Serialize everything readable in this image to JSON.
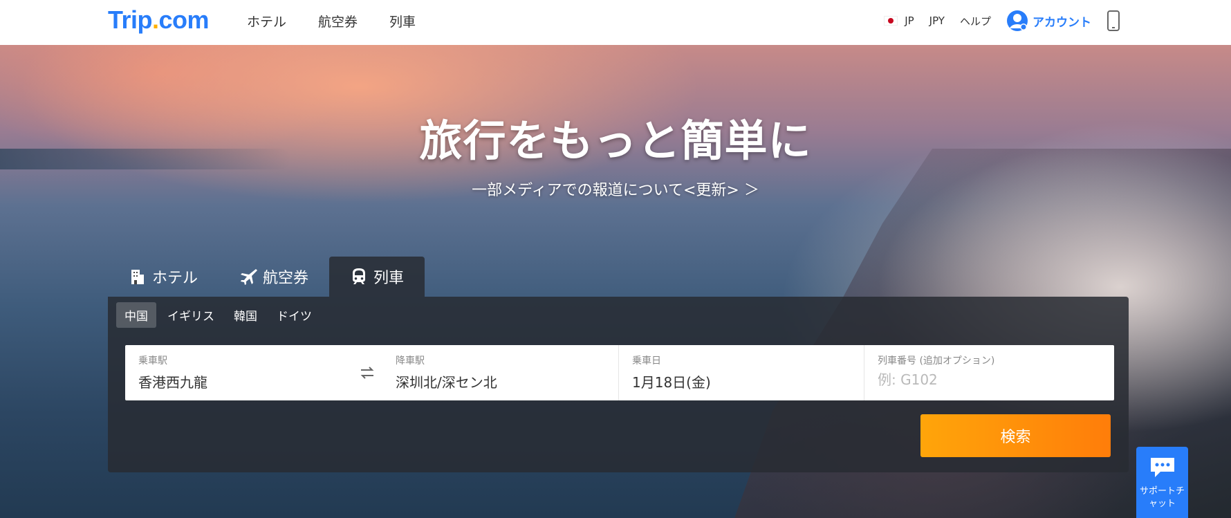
{
  "header": {
    "logo_main": "Trip",
    "logo_dot": ".",
    "logo_suffix": "com",
    "nav": [
      {
        "label": "ホテル"
      },
      {
        "label": "航空券"
      },
      {
        "label": "列車"
      }
    ],
    "language": "JP",
    "currency": "JPY",
    "help": "ヘルプ",
    "account": "アカウント"
  },
  "hero": {
    "title": "旅行をもっと簡単に",
    "notice": "一部メディアでの報道について<更新> ＞"
  },
  "tabs": [
    {
      "label": "ホテル",
      "icon": "hotel-icon"
    },
    {
      "label": "航空券",
      "icon": "plane-icon"
    },
    {
      "label": "列車",
      "icon": "train-icon",
      "active": true
    }
  ],
  "countries": [
    {
      "label": "中国",
      "active": true
    },
    {
      "label": "イギリス"
    },
    {
      "label": "韓国"
    },
    {
      "label": "ドイツ"
    }
  ],
  "form": {
    "departure_label": "乗車駅",
    "departure_value": "香港西九龍",
    "arrival_label": "降車駅",
    "arrival_value": "深圳北/深セン北",
    "date_label": "乗車日",
    "date_value": "1月18日(金)",
    "train_label": "列車番号 (追加オプション)",
    "train_placeholder": "例: G102"
  },
  "search_button": "検索",
  "support": {
    "line1": "サポートチ",
    "line2": "ャット"
  },
  "colors": {
    "brand": "#287dfa",
    "logo_dot": "#ffb000",
    "search_start": "#ffa50a",
    "search_end": "#ff7d0a"
  }
}
